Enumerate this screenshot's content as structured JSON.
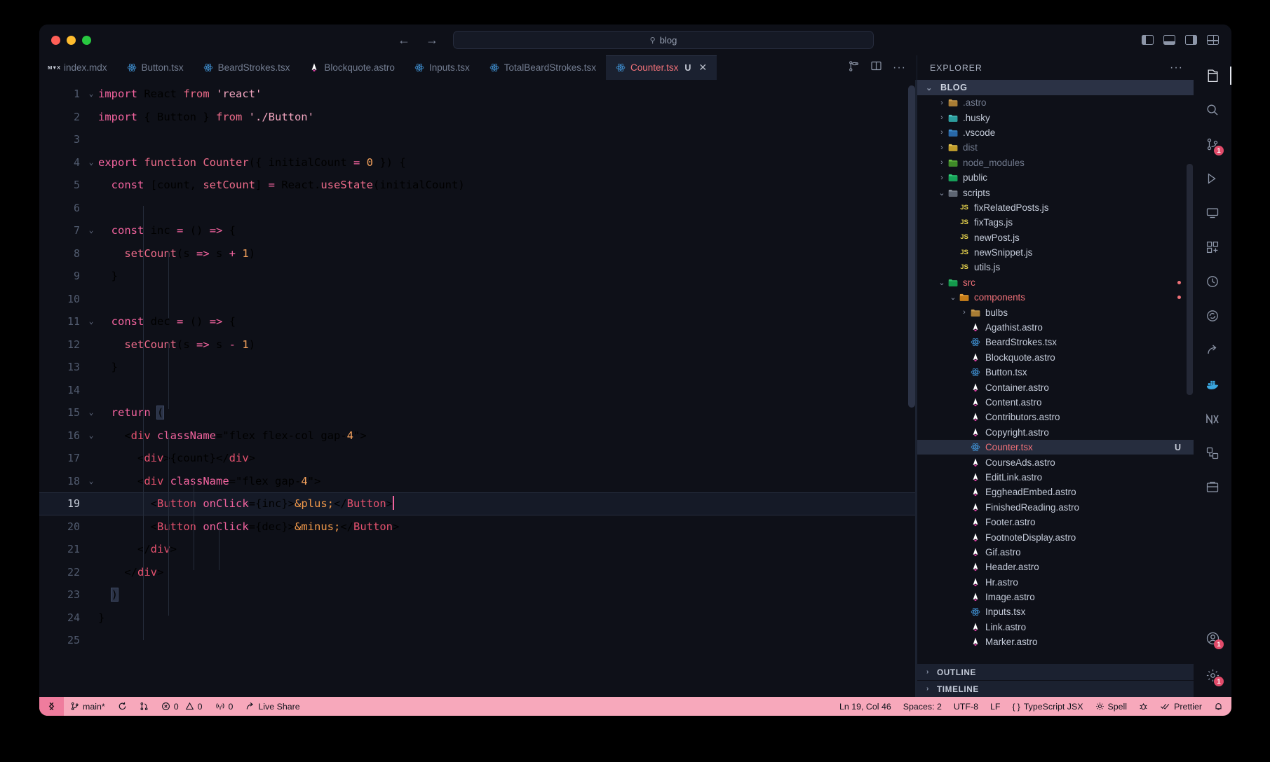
{
  "window": {
    "traffic_lights": [
      "close",
      "minimize",
      "maximize"
    ],
    "search_placeholder": "blog",
    "search_value": "blog",
    "nav_back": "←",
    "nav_forward": "→"
  },
  "tabs": [
    {
      "label": "index.mdx",
      "icon": "mdx-file-icon",
      "active": false,
      "dirty": ""
    },
    {
      "label": "Button.tsx",
      "icon": "react-file-icon",
      "active": false,
      "dirty": ""
    },
    {
      "label": "BeardStrokes.tsx",
      "icon": "react-file-icon",
      "active": false,
      "dirty": ""
    },
    {
      "label": "Blockquote.astro",
      "icon": "astro-file-icon",
      "active": false,
      "dirty": ""
    },
    {
      "label": "Inputs.tsx",
      "icon": "react-file-icon",
      "active": false,
      "dirty": ""
    },
    {
      "label": "TotalBeardStrokes.tsx",
      "icon": "react-file-icon",
      "active": false,
      "dirty": ""
    },
    {
      "label": "Counter.tsx",
      "icon": "react-file-icon",
      "active": true,
      "dirty": "U",
      "close": "✕"
    }
  ],
  "editor": {
    "cursor_line": 19,
    "lines": [
      {
        "n": 1,
        "fold": "⌄",
        "current": false
      },
      {
        "n": 2,
        "fold": "",
        "current": false
      },
      {
        "n": 3,
        "fold": "",
        "current": false
      },
      {
        "n": 4,
        "fold": "⌄",
        "current": false
      },
      {
        "n": 5,
        "fold": "",
        "current": false
      },
      {
        "n": 6,
        "fold": "",
        "current": false
      },
      {
        "n": 7,
        "fold": "⌄",
        "current": false
      },
      {
        "n": 8,
        "fold": "",
        "current": false
      },
      {
        "n": 9,
        "fold": "",
        "current": false
      },
      {
        "n": 10,
        "fold": "",
        "current": false
      },
      {
        "n": 11,
        "fold": "⌄",
        "current": false
      },
      {
        "n": 12,
        "fold": "",
        "current": false
      },
      {
        "n": 13,
        "fold": "",
        "current": false
      },
      {
        "n": 14,
        "fold": "",
        "current": false
      },
      {
        "n": 15,
        "fold": "⌄",
        "current": false
      },
      {
        "n": 16,
        "fold": "⌄",
        "current": false
      },
      {
        "n": 17,
        "fold": "",
        "current": false
      },
      {
        "n": 18,
        "fold": "⌄",
        "current": false
      },
      {
        "n": 19,
        "fold": "",
        "current": true
      },
      {
        "n": 20,
        "fold": "",
        "current": false
      },
      {
        "n": 21,
        "fold": "",
        "current": false
      },
      {
        "n": 22,
        "fold": "",
        "current": false
      },
      {
        "n": 23,
        "fold": "",
        "current": false
      },
      {
        "n": 24,
        "fold": "",
        "current": false
      },
      {
        "n": 25,
        "fold": "",
        "current": false
      }
    ],
    "source": [
      "import React from 'react'",
      "import { Button } from './Button'",
      "",
      "export function Counter({ initialCount = 0 }) {",
      "  const [count, setCount] = React.useState(initialCount)",
      "",
      "  const inc = () => {",
      "    setCount(s => s + 1)",
      "  }",
      "",
      "  const dec = () => {",
      "    setCount(s => s - 1)",
      "  }",
      "",
      "  return (",
      "    <div className=\"flex flex-col gap-4\">",
      "      <div>{count}</div>",
      "      <div className=\"flex gap-4\">",
      "        <Button onClick={inc}>&plus;</Button>",
      "        <Button onClick={dec}>&minus;</Button>",
      "      </div>",
      "    </div>",
      "  )",
      "}",
      ""
    ]
  },
  "explorer": {
    "title": "EXPLORER",
    "more": "···",
    "root": {
      "label": "BLOG",
      "chevron": "⌄"
    },
    "items": [
      {
        "label": ".astro",
        "depth": 1,
        "chevron": "›",
        "icon": "folder-icon",
        "state": "dim"
      },
      {
        "label": ".husky",
        "depth": 1,
        "chevron": "›",
        "icon": "folder-husky-icon",
        "state": "normal"
      },
      {
        "label": ".vscode",
        "depth": 1,
        "chevron": "›",
        "icon": "folder-vscode-icon",
        "state": "normal"
      },
      {
        "label": "dist",
        "depth": 1,
        "chevron": "›",
        "icon": "folder-dist-icon",
        "state": "dim"
      },
      {
        "label": "node_modules",
        "depth": 1,
        "chevron": "›",
        "icon": "folder-node-icon",
        "state": "dim"
      },
      {
        "label": "public",
        "depth": 1,
        "chevron": "›",
        "icon": "folder-public-icon",
        "state": "normal"
      },
      {
        "label": "scripts",
        "depth": 1,
        "chevron": "⌄",
        "icon": "folder-scripts-icon",
        "state": "normal"
      },
      {
        "label": "fixRelatedPosts.js",
        "depth": 2,
        "chevron": "",
        "icon": "js-file-icon",
        "state": "normal"
      },
      {
        "label": "fixTags.js",
        "depth": 2,
        "chevron": "",
        "icon": "js-file-icon",
        "state": "normal"
      },
      {
        "label": "newPost.js",
        "depth": 2,
        "chevron": "",
        "icon": "js-file-icon",
        "state": "normal"
      },
      {
        "label": "newSnippet.js",
        "depth": 2,
        "chevron": "",
        "icon": "js-file-icon",
        "state": "normal"
      },
      {
        "label": "utils.js",
        "depth": 2,
        "chevron": "",
        "icon": "js-file-icon",
        "state": "normal"
      },
      {
        "label": "src",
        "depth": 1,
        "chevron": "⌄",
        "icon": "folder-src-icon",
        "state": "modified",
        "dot": true
      },
      {
        "label": "components",
        "depth": 2,
        "chevron": "⌄",
        "icon": "folder-components-icon",
        "state": "modified",
        "dot": true
      },
      {
        "label": "bulbs",
        "depth": 3,
        "chevron": "›",
        "icon": "folder-icon",
        "state": "normal"
      },
      {
        "label": "Agathist.astro",
        "depth": 3,
        "chevron": "",
        "icon": "astro-file-icon",
        "state": "normal"
      },
      {
        "label": "BeardStrokes.tsx",
        "depth": 3,
        "chevron": "",
        "icon": "react-file-icon",
        "state": "normal"
      },
      {
        "label": "Blockquote.astro",
        "depth": 3,
        "chevron": "",
        "icon": "astro-file-icon",
        "state": "normal"
      },
      {
        "label": "Button.tsx",
        "depth": 3,
        "chevron": "",
        "icon": "react-file-icon",
        "state": "normal"
      },
      {
        "label": "Container.astro",
        "depth": 3,
        "chevron": "",
        "icon": "astro-file-icon",
        "state": "normal"
      },
      {
        "label": "Content.astro",
        "depth": 3,
        "chevron": "",
        "icon": "astro-file-icon",
        "state": "normal"
      },
      {
        "label": "Contributors.astro",
        "depth": 3,
        "chevron": "",
        "icon": "astro-file-icon",
        "state": "normal"
      },
      {
        "label": "Copyright.astro",
        "depth": 3,
        "chevron": "",
        "icon": "astro-file-icon",
        "state": "normal"
      },
      {
        "label": "Counter.tsx",
        "depth": 3,
        "chevron": "",
        "icon": "react-file-icon",
        "state": "selected",
        "badge": "U"
      },
      {
        "label": "CourseAds.astro",
        "depth": 3,
        "chevron": "",
        "icon": "astro-file-icon",
        "state": "normal"
      },
      {
        "label": "EditLink.astro",
        "depth": 3,
        "chevron": "",
        "icon": "astro-file-icon",
        "state": "normal"
      },
      {
        "label": "EggheadEmbed.astro",
        "depth": 3,
        "chevron": "",
        "icon": "astro-file-icon",
        "state": "normal"
      },
      {
        "label": "FinishedReading.astro",
        "depth": 3,
        "chevron": "",
        "icon": "astro-file-icon",
        "state": "normal"
      },
      {
        "label": "Footer.astro",
        "depth": 3,
        "chevron": "",
        "icon": "astro-file-icon",
        "state": "normal"
      },
      {
        "label": "FootnoteDisplay.astro",
        "depth": 3,
        "chevron": "",
        "icon": "astro-file-icon",
        "state": "normal"
      },
      {
        "label": "Gif.astro",
        "depth": 3,
        "chevron": "",
        "icon": "astro-file-icon",
        "state": "normal"
      },
      {
        "label": "Header.astro",
        "depth": 3,
        "chevron": "",
        "icon": "astro-file-icon",
        "state": "normal"
      },
      {
        "label": "Hr.astro",
        "depth": 3,
        "chevron": "",
        "icon": "astro-file-icon",
        "state": "normal"
      },
      {
        "label": "Image.astro",
        "depth": 3,
        "chevron": "",
        "icon": "astro-file-icon",
        "state": "normal"
      },
      {
        "label": "Inputs.tsx",
        "depth": 3,
        "chevron": "",
        "icon": "react-file-icon",
        "state": "normal"
      },
      {
        "label": "Link.astro",
        "depth": 3,
        "chevron": "",
        "icon": "astro-file-icon",
        "state": "normal"
      },
      {
        "label": "Marker.astro",
        "depth": 3,
        "chevron": "",
        "icon": "astro-file-icon",
        "state": "normal"
      }
    ],
    "sections": [
      {
        "label": "OUTLINE",
        "chevron": "›"
      },
      {
        "label": "TIMELINE",
        "chevron": "›"
      }
    ]
  },
  "activity_bar": [
    {
      "name": "explorer-icon",
      "active": true,
      "badge": ""
    },
    {
      "name": "search-icon",
      "active": false,
      "badge": ""
    },
    {
      "name": "source-control-icon",
      "active": false,
      "badge": "1"
    },
    {
      "name": "run-debug-icon",
      "active": false,
      "badge": ""
    },
    {
      "name": "remote-explorer-icon",
      "active": false,
      "badge": ""
    },
    {
      "name": "extensions-icon",
      "active": false,
      "badge": ""
    },
    {
      "name": "testing-icon",
      "active": false,
      "badge": ""
    },
    {
      "name": "sync-icon",
      "active": false,
      "badge": ""
    },
    {
      "name": "share-icon",
      "active": false,
      "badge": ""
    },
    {
      "name": "docker-icon",
      "active": false,
      "badge": ""
    },
    {
      "name": "nx-console-icon",
      "active": false,
      "badge": ""
    },
    {
      "name": "todo-tree-icon",
      "active": false,
      "badge": ""
    },
    {
      "name": "project-manager-icon",
      "active": false,
      "badge": ""
    }
  ],
  "activity_bottom": [
    {
      "name": "accounts-icon",
      "badge": "1"
    },
    {
      "name": "settings-icon",
      "badge": "1"
    }
  ],
  "statusbar": {
    "remote_icon": "remote-window-icon",
    "left": [
      {
        "name": "branch",
        "icon": "git-branch-icon",
        "label": "main*"
      },
      {
        "name": "sync",
        "icon": "sync-icon",
        "label": ""
      },
      {
        "name": "pr",
        "icon": "git-pull-request-icon",
        "label": ""
      },
      {
        "name": "problems",
        "icon": "error-warning-icon",
        "label": "0 ⚠ 0",
        "error": "0",
        "warning": "0"
      },
      {
        "name": "ports",
        "icon": "radio-tower-icon",
        "label": "0"
      },
      {
        "name": "liveshare",
        "icon": "live-share-icon",
        "label": "Live Share"
      }
    ],
    "right": [
      {
        "name": "cursor-position",
        "label": "Ln 19, Col 46"
      },
      {
        "name": "indentation",
        "label": "Spaces: 2"
      },
      {
        "name": "encoding",
        "label": "UTF-8"
      },
      {
        "name": "eol",
        "label": "LF"
      },
      {
        "name": "language-mode",
        "label": "TypeScript JSX",
        "icon": "braces-icon"
      },
      {
        "name": "spell-checker",
        "label": "Spell",
        "icon": "spell-icon"
      },
      {
        "name": "bug-icon",
        "label": "",
        "icon": "bug-icon"
      },
      {
        "name": "prettier",
        "label": "Prettier",
        "icon": "check-check-icon"
      },
      {
        "name": "notifications",
        "label": "",
        "icon": "bell-icon"
      }
    ]
  },
  "colors": {
    "accent_pink": "#f07178",
    "status_bar": "#f7a8bb",
    "editor_bg": "#0e1018",
    "selection": "#262d3e"
  }
}
